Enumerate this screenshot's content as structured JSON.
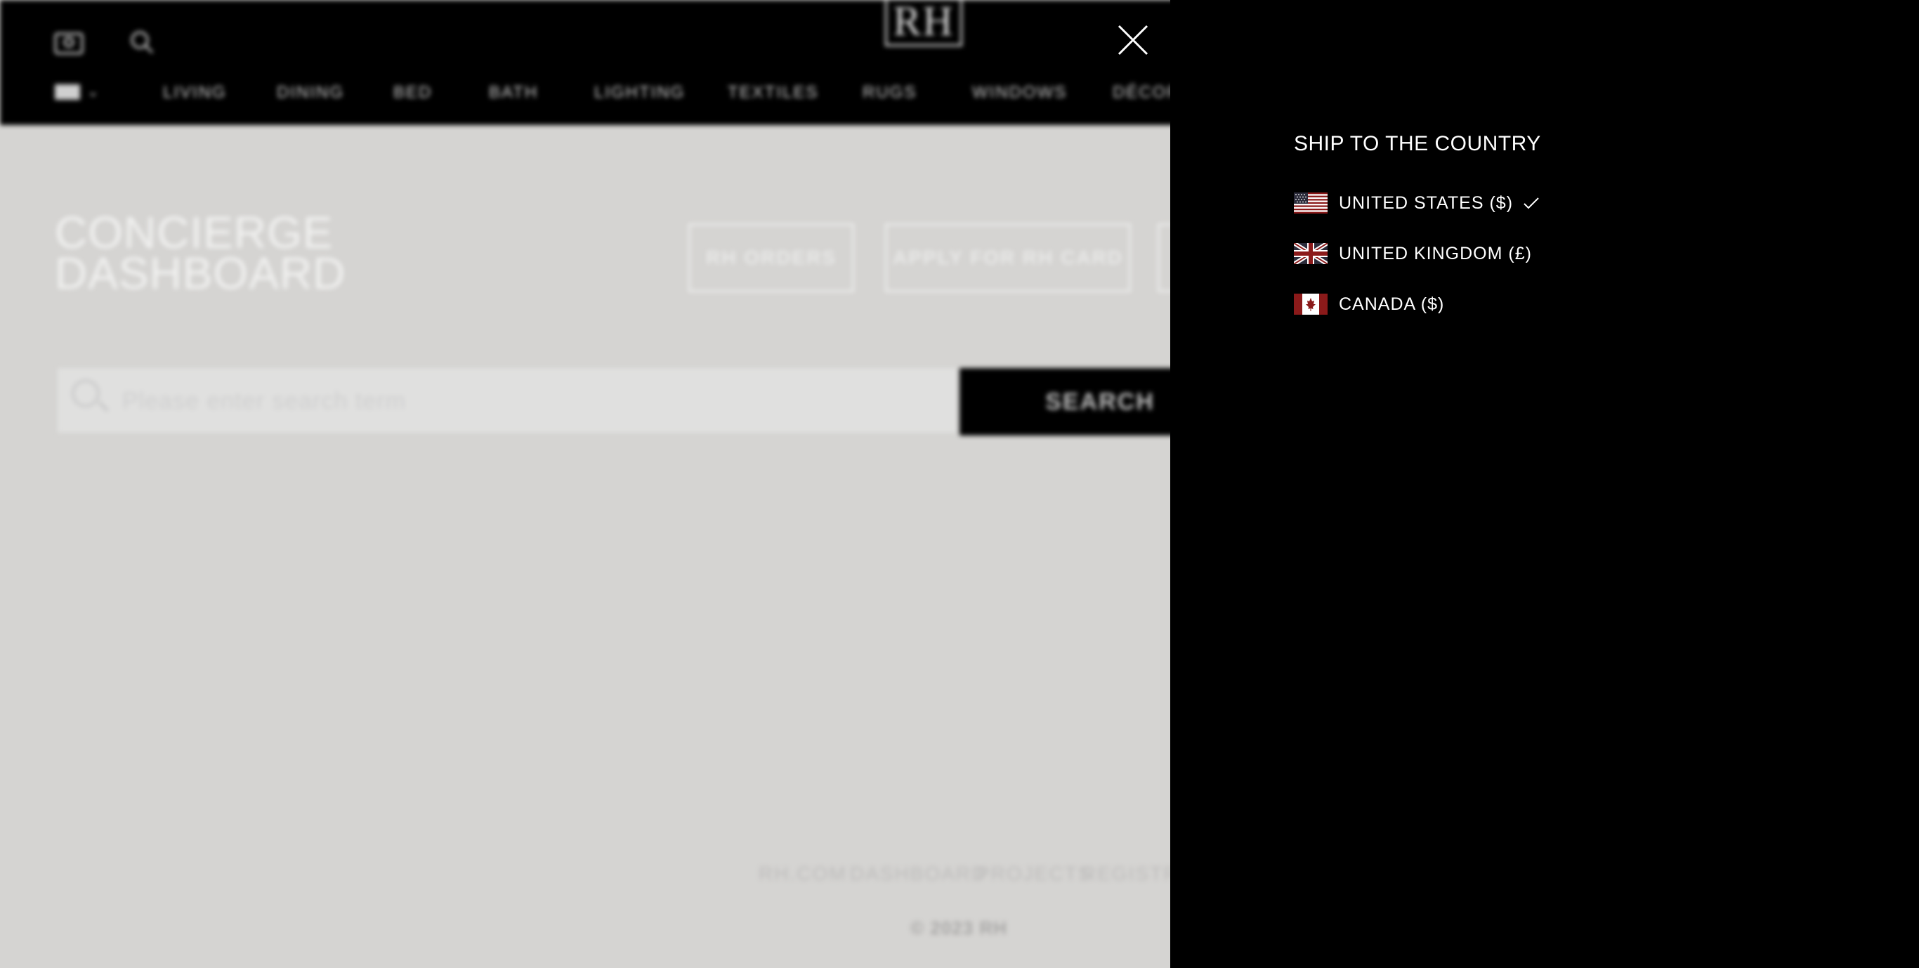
{
  "header": {
    "logo_text": "RH",
    "icons": [
      "account-icon",
      "search-icon"
    ],
    "nav": [
      "LIVING",
      "DINING",
      "BED",
      "BATH",
      "LIGHTING",
      "TEXTILES",
      "RUGS",
      "WINDOWS",
      "DÉCOR"
    ]
  },
  "dashboard": {
    "title_line1": "CONCIERGE",
    "title_line2": "DASHBOARD",
    "buttons": [
      "RH ORDERS",
      "APPLY FOR RH CARD"
    ]
  },
  "search": {
    "placeholder": "Please enter search term",
    "button_label": "SEARCH"
  },
  "footer": {
    "links": [
      "RH.COM",
      "DASHBOARD",
      "PROJECTS",
      "REGISTRY"
    ],
    "copyright": "© 2023 RH"
  },
  "country_panel": {
    "title": "SHIP TO THE COUNTRY",
    "countries": [
      {
        "name": "UNITED STATES ($)",
        "flag": "us-flag",
        "selected": true
      },
      {
        "name": "UNITED KINGDOM (£)",
        "flag": "uk-flag",
        "selected": false
      },
      {
        "name": "CANADA ($)",
        "flag": "canada-flag",
        "selected": false
      }
    ],
    "colors": {
      "panel_bg": "#000000",
      "text": "#ffffff",
      "flag_red": "#8b1a1a"
    }
  }
}
